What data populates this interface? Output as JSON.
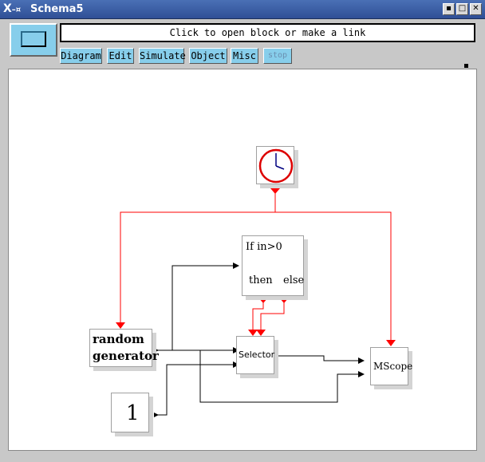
{
  "window": {
    "title": "Schema5",
    "icon": "x-window-icon",
    "controls": [
      "minimize",
      "maximize",
      "close"
    ]
  },
  "toolbar": {
    "message": "Click to open block or make a link",
    "menus": [
      {
        "label": "Diagram",
        "enabled": true
      },
      {
        "label": "Edit",
        "enabled": true
      },
      {
        "label": "Simulate",
        "enabled": true
      },
      {
        "label": "Object",
        "enabled": true
      },
      {
        "label": "Misc",
        "enabled": true
      },
      {
        "label": "stop",
        "enabled": false
      }
    ]
  },
  "diagram": {
    "blocks": {
      "clock": {
        "icon": "clock-icon"
      },
      "if_block": {
        "title": "If in>0",
        "then_label": "then",
        "else_label": "else"
      },
      "random_generator": {
        "line1": "random",
        "line2": "generator"
      },
      "constant": {
        "value": "1"
      },
      "selector": {
        "label": "Selector"
      },
      "mscope": {
        "label": "MScope"
      }
    },
    "colors": {
      "event_link": "#ff0000",
      "regular_link": "#000000",
      "clock_circle": "#dd0000",
      "clock_hand": "#000080",
      "palette_accent": "#87ceeb"
    }
  }
}
